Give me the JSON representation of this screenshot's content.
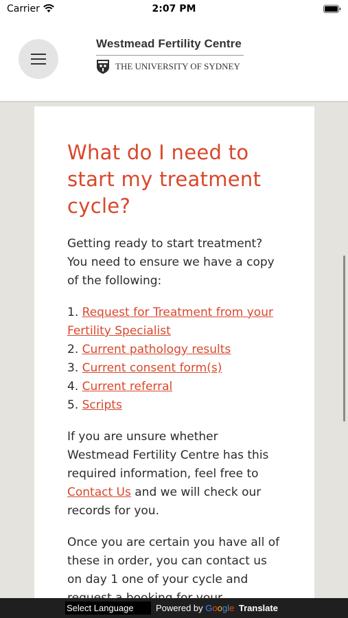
{
  "status_bar": {
    "carrier": "Carrier",
    "time": "2:07 PM"
  },
  "header": {
    "logo_title": "Westmead Fertility Centre",
    "university": "THE UNIVERSITY OF SYDNEY"
  },
  "article": {
    "heading": "What do I need to start my treatment cycle?",
    "intro": "Getting ready to start treatment? You need to ensure we have a copy of the following:",
    "items": [
      {
        "num": "1.",
        "label": "Request for Treatment from your Fertility Specialist"
      },
      {
        "num": "2.",
        "label": "Current pathology results"
      },
      {
        "num": "3.",
        "label": "Current consent form(s)"
      },
      {
        "num": "4.",
        "label": "Current referral"
      },
      {
        "num": "5.",
        "label": "Scripts"
      }
    ],
    "para2_before": "If you are unsure whether Westmead Fertility Centre has this required information, feel free to ",
    "para2_link": "Contact Us",
    "para2_after": " and we will check our records for you.",
    "para3": "Once you are certain you have all of these in order, you can contact us on day 1 one of your cycle and request a booking for your"
  },
  "translate_bar": {
    "select_label": "Select Language",
    "powered_by": "Powered by",
    "google_letters": [
      "G",
      "o",
      "o",
      "g",
      "l",
      "e"
    ],
    "translate": "Translate"
  },
  "colors": {
    "accent": "#d9472b",
    "page_bg": "#e4e3dd",
    "translate_bar": "#1f1f1f"
  }
}
